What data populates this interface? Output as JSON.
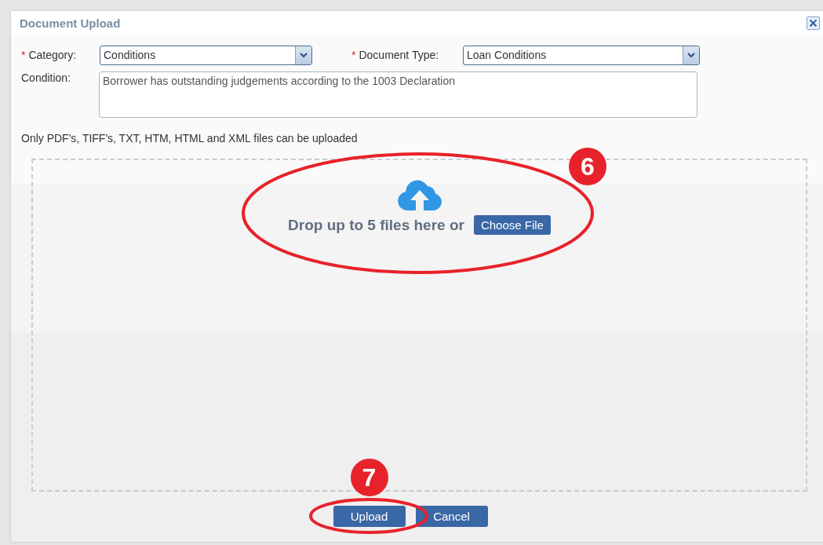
{
  "dialog": {
    "title": "Document Upload"
  },
  "fields": [
    {
      "kind": "select",
      "required_mark": "*",
      "label": "Category:",
      "value": "Conditions"
    },
    {
      "kind": "select",
      "required_mark": "*",
      "label": "Document Type:",
      "value": "Loan Conditions"
    }
  ],
  "condition": {
    "label": "Condition:",
    "value": "Borrower has outstanding judgements according to the 1003 Declaration"
  },
  "note": "Only PDF's, TIFF's, TXT, HTM, HTML and XML files can be uploaded",
  "dropzone": {
    "prompt": "Drop up to 5 files here or",
    "button": "Choose File"
  },
  "buttons": [
    {
      "label": "Upload"
    },
    {
      "label": "Cancel"
    }
  ],
  "callouts": [
    {
      "number": "6"
    },
    {
      "number": "7"
    }
  ]
}
